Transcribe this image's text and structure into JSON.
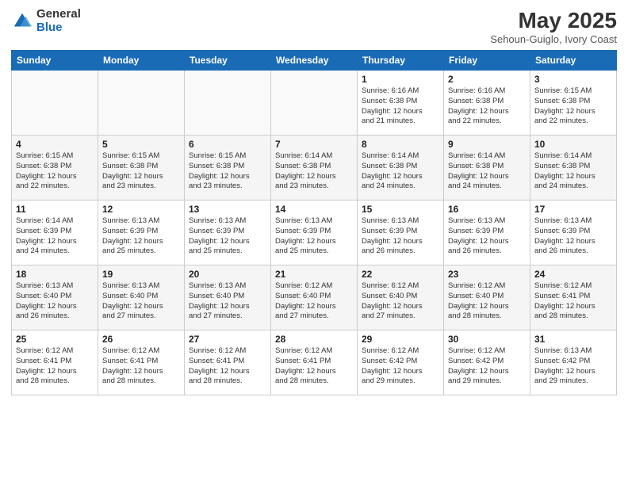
{
  "logo": {
    "general": "General",
    "blue": "Blue"
  },
  "title": "May 2025",
  "location": "Sehoun-Guiglo, Ivory Coast",
  "days_of_week": [
    "Sunday",
    "Monday",
    "Tuesday",
    "Wednesday",
    "Thursday",
    "Friday",
    "Saturday"
  ],
  "weeks": [
    [
      {
        "day": "",
        "info": ""
      },
      {
        "day": "",
        "info": ""
      },
      {
        "day": "",
        "info": ""
      },
      {
        "day": "",
        "info": ""
      },
      {
        "day": "1",
        "info": "Sunrise: 6:16 AM\nSunset: 6:38 PM\nDaylight: 12 hours\nand 21 minutes."
      },
      {
        "day": "2",
        "info": "Sunrise: 6:16 AM\nSunset: 6:38 PM\nDaylight: 12 hours\nand 22 minutes."
      },
      {
        "day": "3",
        "info": "Sunrise: 6:15 AM\nSunset: 6:38 PM\nDaylight: 12 hours\nand 22 minutes."
      }
    ],
    [
      {
        "day": "4",
        "info": "Sunrise: 6:15 AM\nSunset: 6:38 PM\nDaylight: 12 hours\nand 22 minutes."
      },
      {
        "day": "5",
        "info": "Sunrise: 6:15 AM\nSunset: 6:38 PM\nDaylight: 12 hours\nand 23 minutes."
      },
      {
        "day": "6",
        "info": "Sunrise: 6:15 AM\nSunset: 6:38 PM\nDaylight: 12 hours\nand 23 minutes."
      },
      {
        "day": "7",
        "info": "Sunrise: 6:14 AM\nSunset: 6:38 PM\nDaylight: 12 hours\nand 23 minutes."
      },
      {
        "day": "8",
        "info": "Sunrise: 6:14 AM\nSunset: 6:38 PM\nDaylight: 12 hours\nand 24 minutes."
      },
      {
        "day": "9",
        "info": "Sunrise: 6:14 AM\nSunset: 6:38 PM\nDaylight: 12 hours\nand 24 minutes."
      },
      {
        "day": "10",
        "info": "Sunrise: 6:14 AM\nSunset: 6:38 PM\nDaylight: 12 hours\nand 24 minutes."
      }
    ],
    [
      {
        "day": "11",
        "info": "Sunrise: 6:14 AM\nSunset: 6:39 PM\nDaylight: 12 hours\nand 24 minutes."
      },
      {
        "day": "12",
        "info": "Sunrise: 6:13 AM\nSunset: 6:39 PM\nDaylight: 12 hours\nand 25 minutes."
      },
      {
        "day": "13",
        "info": "Sunrise: 6:13 AM\nSunset: 6:39 PM\nDaylight: 12 hours\nand 25 minutes."
      },
      {
        "day": "14",
        "info": "Sunrise: 6:13 AM\nSunset: 6:39 PM\nDaylight: 12 hours\nand 25 minutes."
      },
      {
        "day": "15",
        "info": "Sunrise: 6:13 AM\nSunset: 6:39 PM\nDaylight: 12 hours\nand 26 minutes."
      },
      {
        "day": "16",
        "info": "Sunrise: 6:13 AM\nSunset: 6:39 PM\nDaylight: 12 hours\nand 26 minutes."
      },
      {
        "day": "17",
        "info": "Sunrise: 6:13 AM\nSunset: 6:39 PM\nDaylight: 12 hours\nand 26 minutes."
      }
    ],
    [
      {
        "day": "18",
        "info": "Sunrise: 6:13 AM\nSunset: 6:40 PM\nDaylight: 12 hours\nand 26 minutes."
      },
      {
        "day": "19",
        "info": "Sunrise: 6:13 AM\nSunset: 6:40 PM\nDaylight: 12 hours\nand 27 minutes."
      },
      {
        "day": "20",
        "info": "Sunrise: 6:13 AM\nSunset: 6:40 PM\nDaylight: 12 hours\nand 27 minutes."
      },
      {
        "day": "21",
        "info": "Sunrise: 6:12 AM\nSunset: 6:40 PM\nDaylight: 12 hours\nand 27 minutes."
      },
      {
        "day": "22",
        "info": "Sunrise: 6:12 AM\nSunset: 6:40 PM\nDaylight: 12 hours\nand 27 minutes."
      },
      {
        "day": "23",
        "info": "Sunrise: 6:12 AM\nSunset: 6:40 PM\nDaylight: 12 hours\nand 28 minutes."
      },
      {
        "day": "24",
        "info": "Sunrise: 6:12 AM\nSunset: 6:41 PM\nDaylight: 12 hours\nand 28 minutes."
      }
    ],
    [
      {
        "day": "25",
        "info": "Sunrise: 6:12 AM\nSunset: 6:41 PM\nDaylight: 12 hours\nand 28 minutes."
      },
      {
        "day": "26",
        "info": "Sunrise: 6:12 AM\nSunset: 6:41 PM\nDaylight: 12 hours\nand 28 minutes."
      },
      {
        "day": "27",
        "info": "Sunrise: 6:12 AM\nSunset: 6:41 PM\nDaylight: 12 hours\nand 28 minutes."
      },
      {
        "day": "28",
        "info": "Sunrise: 6:12 AM\nSunset: 6:41 PM\nDaylight: 12 hours\nand 28 minutes."
      },
      {
        "day": "29",
        "info": "Sunrise: 6:12 AM\nSunset: 6:42 PM\nDaylight: 12 hours\nand 29 minutes."
      },
      {
        "day": "30",
        "info": "Sunrise: 6:12 AM\nSunset: 6:42 PM\nDaylight: 12 hours\nand 29 minutes."
      },
      {
        "day": "31",
        "info": "Sunrise: 6:13 AM\nSunset: 6:42 PM\nDaylight: 12 hours\nand 29 minutes."
      }
    ]
  ]
}
